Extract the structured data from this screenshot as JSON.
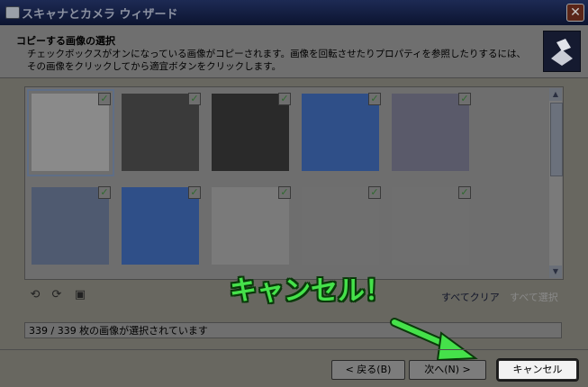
{
  "window": {
    "title": "スキャナとカメラ ウィザード",
    "close_label": "✕"
  },
  "header": {
    "title": "コピーする画像の選択",
    "description": "チェックボックスがオンになっている画像がコピーされます。画像を回転させたりプロパティを参照したりするには、その画像をクリックしてから適宜ボタンをクリックします。"
  },
  "thumbnails": [
    {
      "checked": true,
      "selected": true
    },
    {
      "checked": true
    },
    {
      "checked": true
    },
    {
      "checked": true
    },
    {
      "checked": true
    },
    {
      "checked": true
    },
    {
      "checked": true
    },
    {
      "checked": true
    },
    {
      "checked": true
    },
    {
      "checked": true
    }
  ],
  "toolbar": {
    "rotate_left_icon": "rotate-left-icon",
    "rotate_right_icon": "rotate-right-icon",
    "properties_icon": "properties-icon",
    "clear_all_label": "すべてクリア",
    "select_all_label": "すべて選択"
  },
  "overlay": {
    "caption": "キャンセル！",
    "color": "#45e14a"
  },
  "status": {
    "text": "339 / 339 枚の画像が選択されています"
  },
  "buttons": {
    "back_label": "< 戻る(B)",
    "next_label": "次へ(N) >",
    "cancel_label": "キャンセル"
  }
}
